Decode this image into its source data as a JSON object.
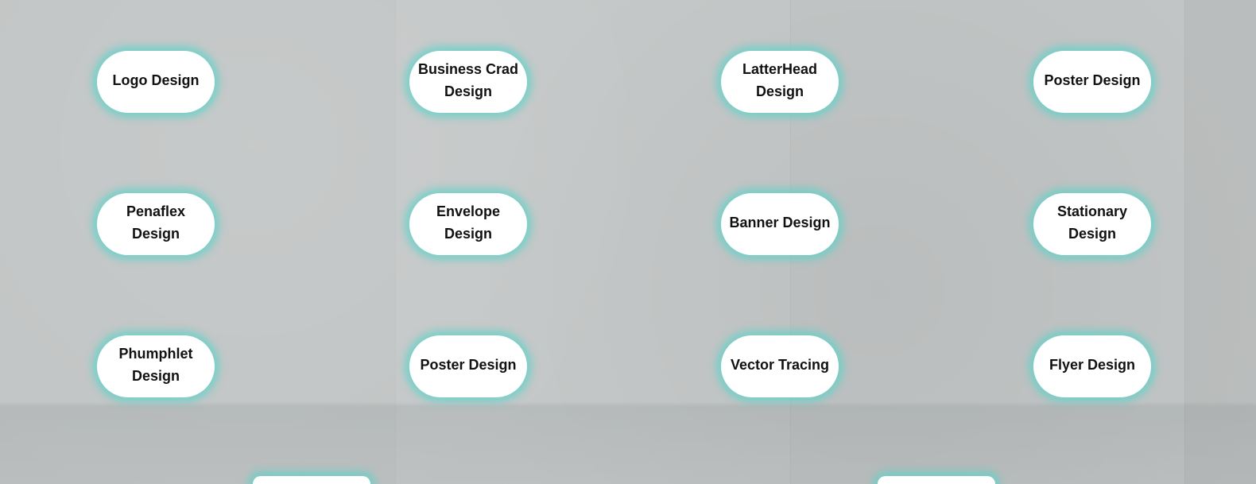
{
  "services": {
    "items": [
      {
        "label": "Logo Design"
      },
      {
        "label": "Business Crad Design"
      },
      {
        "label": "LatterHead Design"
      },
      {
        "label": "Poster Design"
      },
      {
        "label": "Penaflex Design"
      },
      {
        "label": "Envelope Design"
      },
      {
        "label": "Banner Design"
      },
      {
        "label": "Stationary Design"
      },
      {
        "label": "Phumphlet Design"
      },
      {
        "label": "Poster Design"
      },
      {
        "label": "Vector Tracing"
      },
      {
        "label": "Flyer Design"
      }
    ]
  },
  "colors": {
    "glow": "#5fd2c8",
    "pill_background": "#ffffff",
    "text": "#111111",
    "wall": "#c2c5c5"
  }
}
